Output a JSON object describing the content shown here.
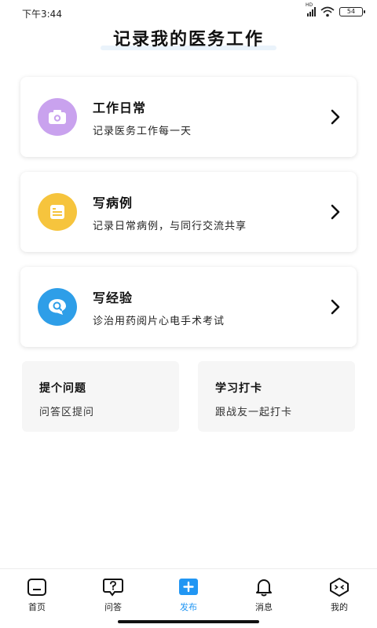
{
  "status_bar": {
    "time": "下午3:44",
    "network_label": "HD",
    "battery": "54"
  },
  "page": {
    "title": "记录我的医务工作"
  },
  "cards": [
    {
      "title": "工作日常",
      "desc": "记录医务工作每一天",
      "icon": "camera-icon",
      "icon_color": "#c9a2ee"
    },
    {
      "title": "写病例",
      "desc": "记录日常病例，与同行交流共享",
      "icon": "document-icon",
      "icon_color": "#f6c43d"
    },
    {
      "title": "写经验",
      "desc": "诊治用药阅片心电手术考试",
      "icon": "chat-search-icon",
      "icon_color": "#2e9ee8"
    }
  ],
  "tiles": [
    {
      "title": "提个问题",
      "desc": "问答区提问"
    },
    {
      "title": "学习打卡",
      "desc": "跟战友一起打卡"
    }
  ],
  "nav": {
    "active": "发布",
    "accent_color": "#2196f3",
    "items": [
      {
        "label": "首页",
        "icon": "home-icon"
      },
      {
        "label": "问答",
        "icon": "question-bubble-icon"
      },
      {
        "label": "发布",
        "icon": "plus-icon"
      },
      {
        "label": "消息",
        "icon": "bell-icon"
      },
      {
        "label": "我的",
        "icon": "profile-face-icon"
      }
    ]
  }
}
